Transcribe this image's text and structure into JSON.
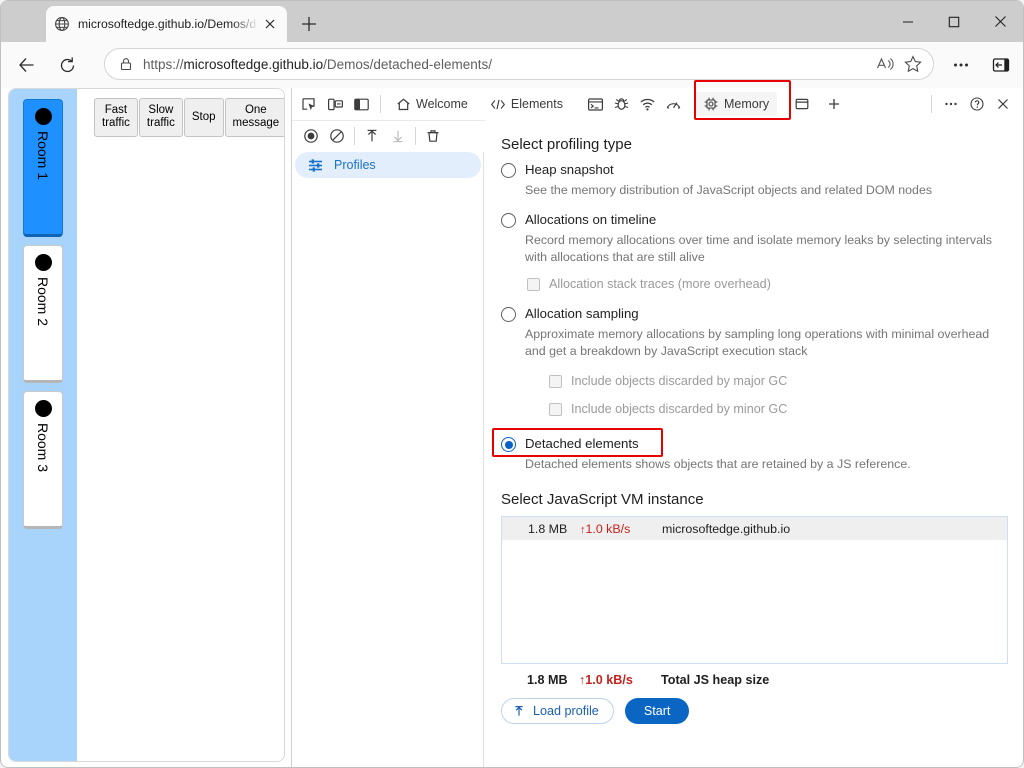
{
  "browser": {
    "tab": {
      "title": "microsoftedge.github.io/Demos/d",
      "favicon_icon": "globe-icon",
      "close_icon": "close-icon"
    },
    "new_tab_icon": "plus-icon",
    "window_controls": {
      "minimize_icon": "minimize-icon",
      "maximize_icon": "maximize-icon",
      "close_icon": "close-icon"
    },
    "toolbar": {
      "back_icon": "back-arrow-icon",
      "reload_icon": "reload-icon",
      "lock_icon": "lock-icon",
      "url_scheme": "https://",
      "url_host": "microsoftedge.github.io",
      "url_path": "/Demos/detached-elements/",
      "read_aloud_icon": "read-aloud-icon",
      "favorite_icon": "star-icon",
      "settings_icon": "ellipsis-icon",
      "sidebar_icon": "split-screen-icon"
    }
  },
  "page": {
    "rooms": [
      {
        "label": "Room 1",
        "active": true
      },
      {
        "label": "Room 2",
        "active": false
      },
      {
        "label": "Room 3",
        "active": false
      }
    ],
    "buttons": [
      {
        "label": "Fast\ntraffic"
      },
      {
        "label": "Slow\ntraffic"
      },
      {
        "label": "Stop"
      },
      {
        "label": "One\nmessage"
      }
    ]
  },
  "devtools": {
    "toolbar": {
      "inspect_icon": "inspect-element-icon",
      "device_icon": "device-emulation-icon",
      "dock_icon": "dock-side-icon",
      "tabs": [
        {
          "label": "Welcome",
          "icon": "home-icon",
          "selected": false
        },
        {
          "label": "Elements",
          "icon": "code-brackets-icon",
          "selected": false
        },
        {
          "label": "Memory",
          "icon": "memory-chip-icon",
          "selected": true,
          "highlighted": true
        }
      ],
      "icon_tabs": [
        {
          "icon": "console-icon"
        },
        {
          "icon": "sources-bug-icon"
        },
        {
          "icon": "network-wifi-icon"
        },
        {
          "icon": "performance-gauge-icon"
        }
      ],
      "more_panels_icon": "more-panels-icon",
      "add_panel_icon": "plus-icon",
      "more_options_icon": "ellipsis-icon",
      "help_icon": "help-question-icon",
      "close_icon": "close-icon"
    },
    "subbar": {
      "record_icon": "record-circle-icon",
      "clear_icon": "clear-prohibit-icon",
      "load_icon": "upload-arrow-icon",
      "save_icon": "download-arrow-icon",
      "delete_icon": "trash-icon"
    },
    "sidebar": {
      "items": [
        {
          "label": "Profiles",
          "icon": "profiles-sliders-icon",
          "selected": true
        }
      ]
    },
    "main": {
      "profiling_title": "Select profiling type",
      "options": [
        {
          "label": "Heap snapshot",
          "checked": false,
          "description": "See the memory distribution of JavaScript objects and related DOM nodes"
        },
        {
          "label": "Allocations on timeline",
          "checked": false,
          "description": "Record memory allocations over time and isolate memory leaks by selecting intervals with allocations that are still alive"
        },
        {
          "label": "Allocation sampling",
          "checked": false,
          "description": "Approximate memory allocations by sampling long operations with minimal overhead and get a breakdown by JavaScript execution stack"
        },
        {
          "label": "Detached elements",
          "checked": true,
          "highlighted": true,
          "description": "Detached elements shows objects that are retained by a JS reference."
        }
      ],
      "checkboxes": [
        {
          "label": "Allocation stack traces (more overhead)",
          "checked": false,
          "indent": 1
        },
        {
          "label": "Include objects discarded by major GC",
          "checked": false,
          "indent": 2
        },
        {
          "label": "Include objects discarded by minor GC",
          "checked": false,
          "indent": 2
        }
      ],
      "vm_title": "Select JavaScript VM instance",
      "vm_rows": [
        {
          "size": "1.8 MB",
          "rate": "1.0 kB/s",
          "rate_arrow": "↑",
          "host": "microsoftedge.github.io"
        }
      ],
      "totals": {
        "size": "1.8 MB",
        "rate": "1.0 kB/s",
        "rate_arrow": "↑",
        "label": "Total JS heap size"
      },
      "load_profile_label": "Load profile",
      "load_profile_icon": "upload-arrow-icon",
      "start_label": "Start"
    }
  },
  "colors": {
    "highlight_red": "#e60000",
    "accent_blue": "#0b66c3",
    "room_active_blue": "#1e90ff",
    "rail_blue": "#a8d4fb",
    "rate_red": "#c5231d"
  }
}
